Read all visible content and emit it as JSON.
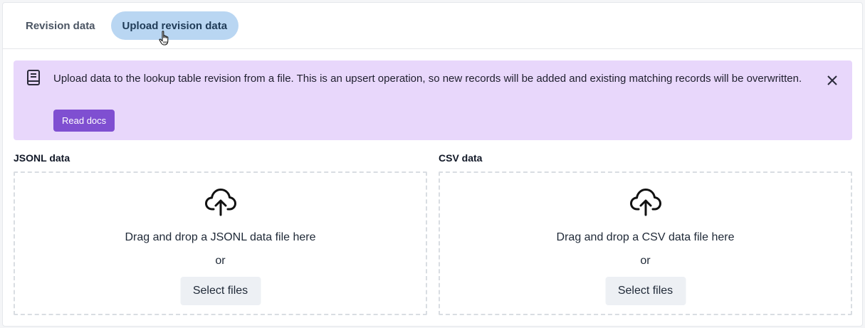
{
  "tabs": [
    {
      "label": "Revision data",
      "active": false
    },
    {
      "label": "Upload revision data",
      "active": true
    }
  ],
  "banner": {
    "message": "Upload data to the lookup table revision from a file. This is an upsert operation, so new records will be added and existing matching records will be overwritten.",
    "button_label": "Read docs",
    "icon": "book-icon",
    "close_icon": "close-icon",
    "background_color": "#e8d7fb",
    "button_color": "#7f4fd1"
  },
  "uploads": {
    "jsonl": {
      "title": "JSONL data",
      "drag_text": "Drag and drop a JSONL data file here",
      "or_text": "or",
      "button_label": "Select files",
      "icon": "cloud-upload-icon"
    },
    "csv": {
      "title": "CSV data",
      "drag_text": "Drag and drop a CSV data file here",
      "or_text": "or",
      "button_label": "Select files",
      "icon": "cloud-upload-icon"
    }
  },
  "colors": {
    "active_tab": "#b9d6f2",
    "active_tab_text": "#1f3b57"
  }
}
